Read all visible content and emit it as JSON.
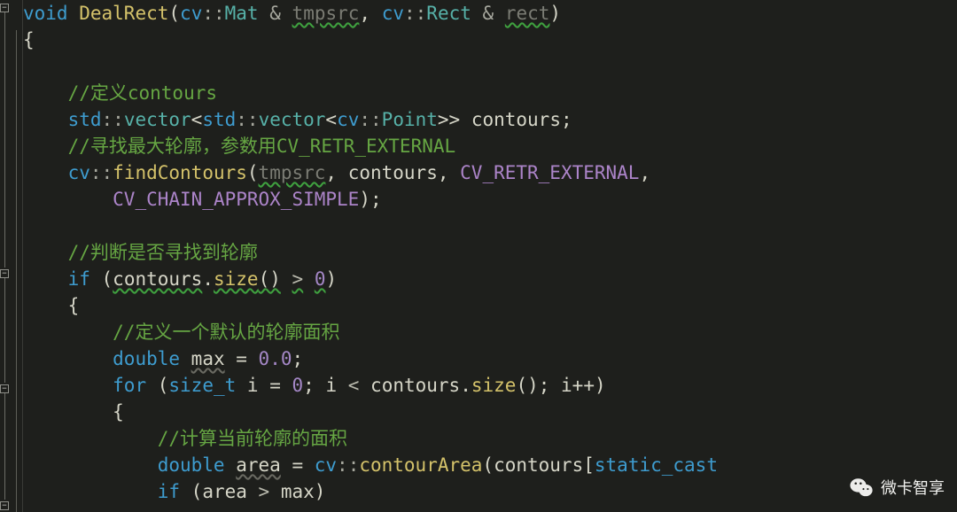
{
  "code": {
    "l1": {
      "kw_void": "void",
      "fn": "DealRect",
      "ns_cv1": "cv",
      "ty_mat": "Mat",
      "amp1": "&",
      "p_tmpsrc": "tmpsrc",
      "ns_cv2": "cv",
      "ty_rect": "Rect",
      "amp2": "&",
      "p_rect": "rect"
    },
    "l2": {
      "brace": "{"
    },
    "l4": {
      "cmt": "//定义contours"
    },
    "l5": {
      "ns_std1": "std",
      "vec1": "vector",
      "ns_std2": "std",
      "vec2": "vector",
      "ns_cv": "cv",
      "pt": "Point",
      "var": "contours",
      "semi": ";"
    },
    "l6": {
      "cmt": "//寻找最大轮廓，参数用CV_RETR_EXTERNAL"
    },
    "l7": {
      "ns_cv": "cv",
      "fn": "findContours",
      "a1": "tmpsrc",
      "sep1": ", ",
      "a2": "contours",
      "sep2": ", ",
      "a3": "CV_RETR_EXTERNAL",
      "tail": ","
    },
    "l8": {
      "a4": "CV_CHAIN_APPROX_SIMPLE",
      "close": ");"
    },
    "l10": {
      "cmt": "//判断是否寻找到轮廓"
    },
    "l11": {
      "kw_if": "if",
      "open": " (",
      "obj": "contours",
      "dot": ".",
      "fn": "size",
      "call": "()",
      "sp": " ",
      "gt": ">",
      "sp2": " ",
      "zero": "0",
      "close": ")"
    },
    "l12": {
      "brace": "{"
    },
    "l13": {
      "cmt": "//定义一个默认的轮廓面积"
    },
    "l14": {
      "kw": "double",
      "var": "max",
      "eq": " = ",
      "val": "0.0",
      "semi": ";"
    },
    "l15": {
      "kw": "for",
      "open": " (",
      "ty": "size_t",
      "var": "i",
      "eq": " = ",
      "zero": "0",
      "sep": "; ",
      "var2": "i",
      "lt": " < ",
      "obj": "contours",
      "dot": ".",
      "fn": "size",
      "call": "()",
      "sep2": "; ",
      "inc": "i++",
      "close": ")"
    },
    "l16": {
      "brace": "{"
    },
    "l17": {
      "cmt": "//计算当前轮廓的面积"
    },
    "l18": {
      "kw": "double",
      "var": "area",
      "eq": " = ",
      "ns": "cv",
      "dd": "::",
      "fn": "contourArea",
      "open": "(",
      "obj": "contours",
      "br": "[",
      "sc": "static_cast",
      "trail": "…",
      "semi": ";"
    },
    "l19": {
      "kw": "if",
      "open": " (",
      "a": "area",
      "gt": " > ",
      "b": "max",
      "close": ")"
    }
  },
  "watermark": {
    "text": "微卡智享"
  }
}
